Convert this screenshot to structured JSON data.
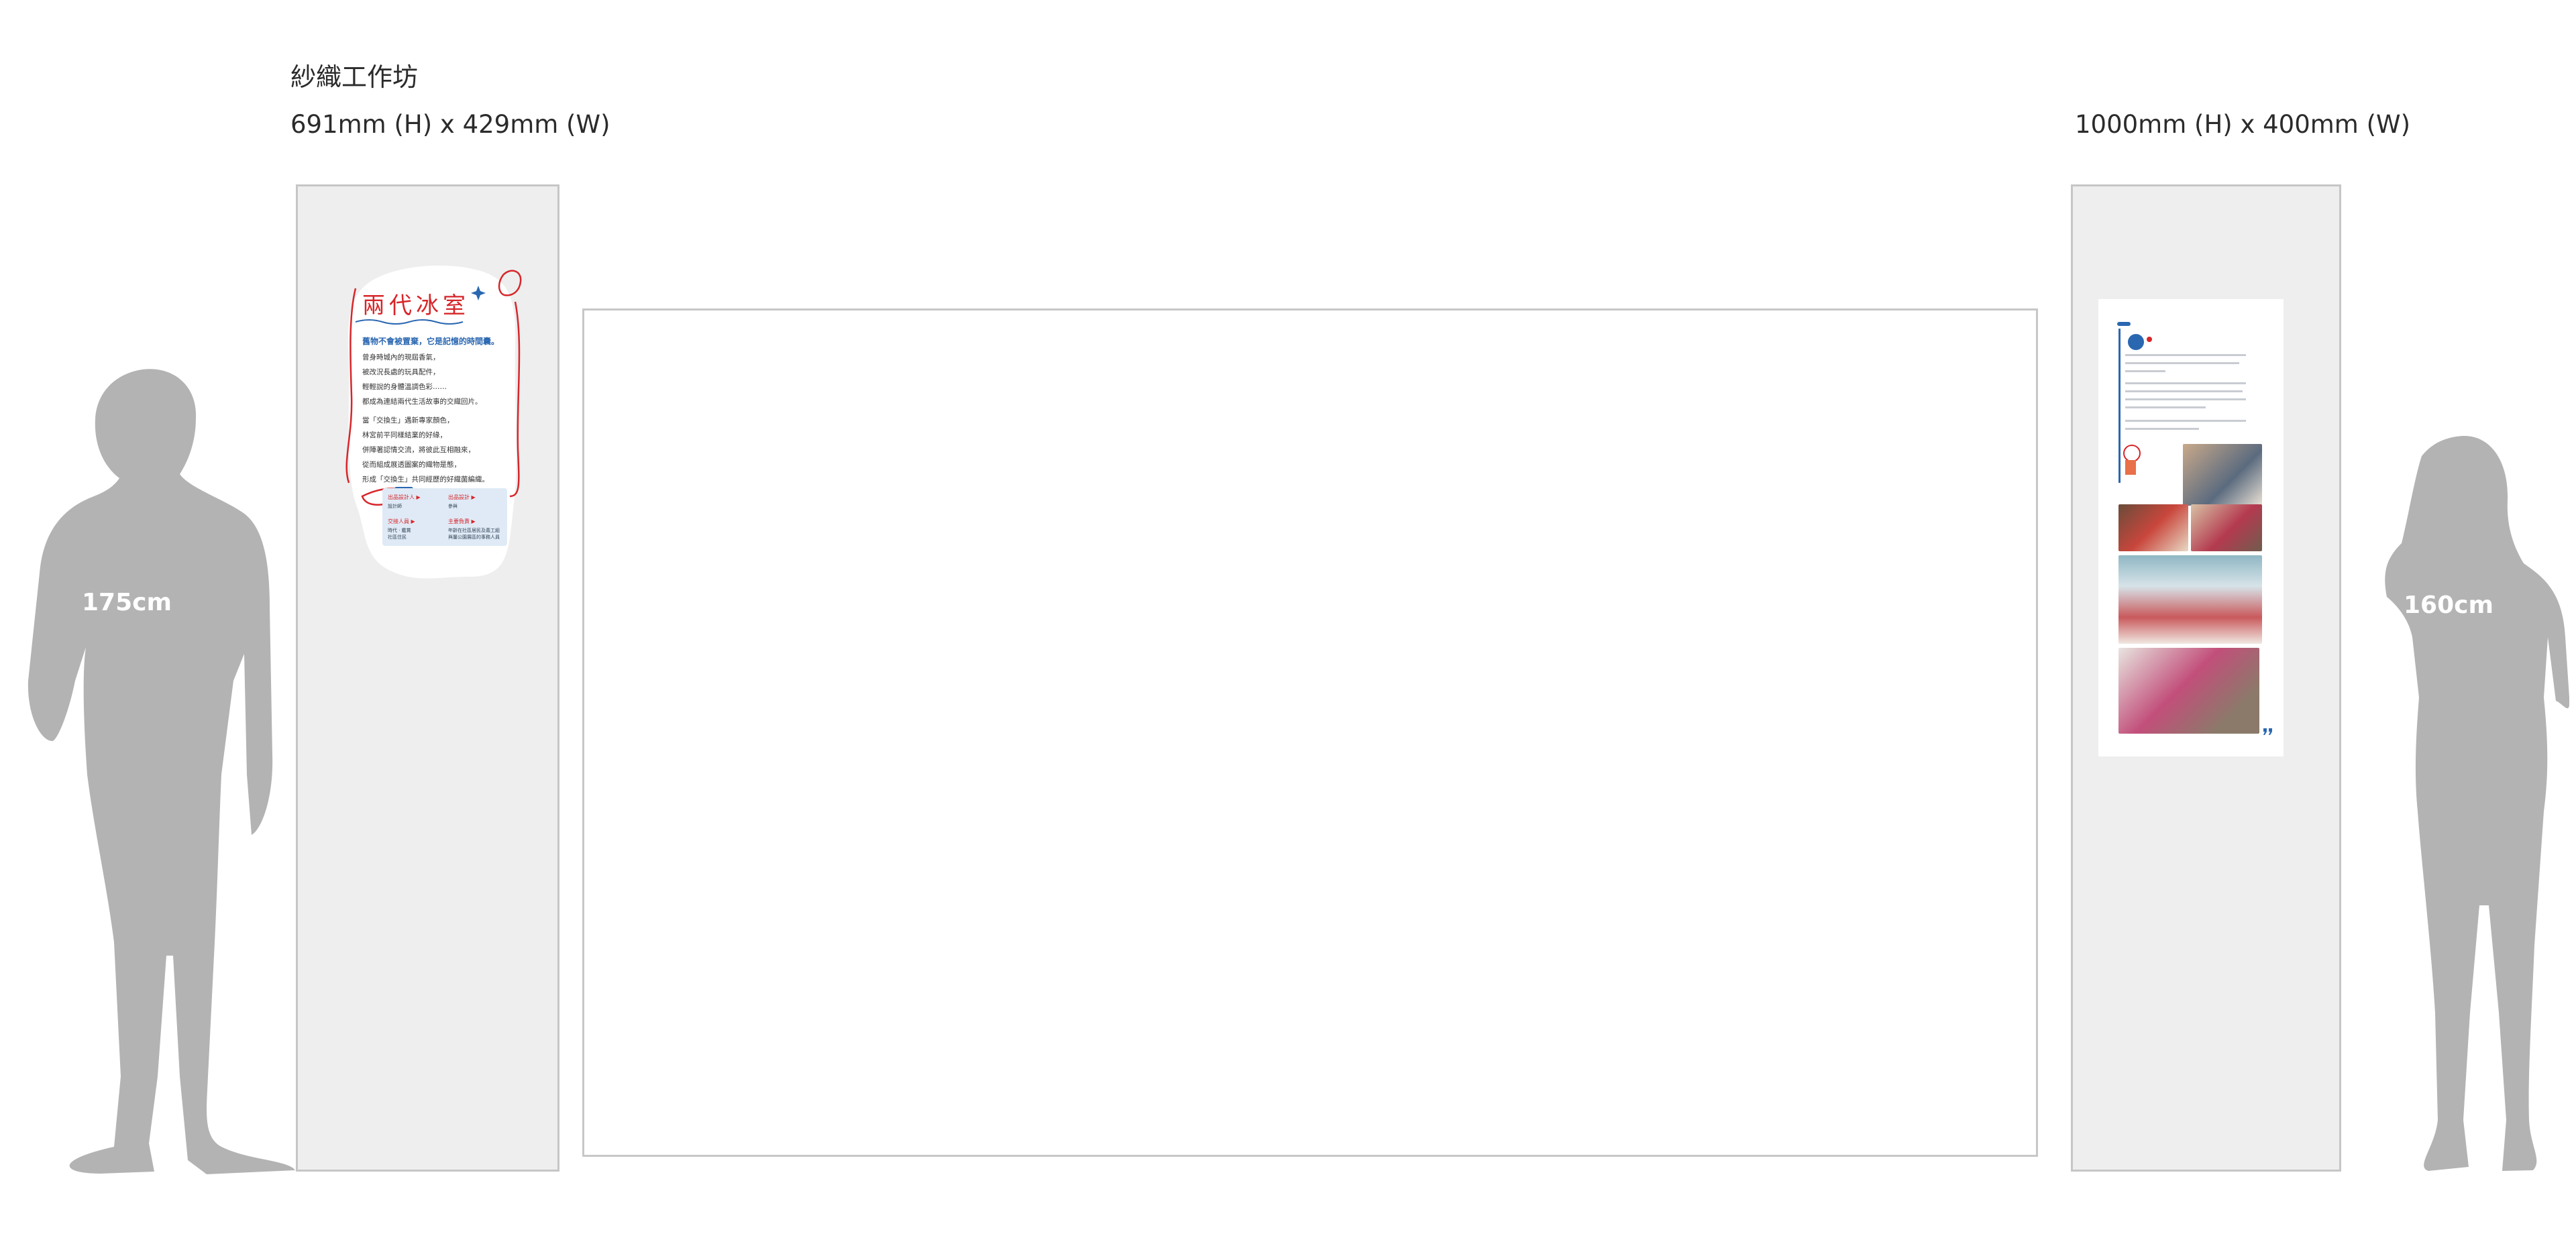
{
  "workshop_title": "紗織工作坊",
  "left_dimension": "691mm (H) x 429mm (W)",
  "right_dimension": "1000mm (H) x 400mm (W)",
  "people": [
    {
      "height_label": "175cm"
    },
    {
      "height_label": "160cm"
    }
  ],
  "left_poster": {
    "title": "兩代冰室",
    "subtitle": "舊物不會被置棄，它是記憶的時間囊。",
    "paragraph1": [
      "曾身時城內的現屆香氣，",
      "被改況長處的玩具配件，",
      "輕輕說的身體溫調色彩……",
      "都成為連結兩代生活故事的交織回片。"
    ],
    "paragraph2": [
      "當「交換生」遇新專家顏色，",
      "林宮前平同樣結業的好緣，",
      "併陣著認情交流，將彼此互相融來，",
      "從而組成展透圖案的織物是態，",
      "形成「交換生」共同經歷的好織菌編織。"
    ],
    "box": {
      "a_title": "出品設計人 ▶",
      "a_sub": "設計師",
      "b_title": "出品設計 ▶",
      "b_sub": "參與",
      "c_title": "交接人員 ▶",
      "c_sub": "時代 · 鑑賞\n社區住民",
      "d_title": "主要負責 ▶",
      "d_sub": "年齡在社區居民及義工組\n與屬公園展區的事務人員"
    }
  },
  "colors": {
    "panel_bg": "#eeeeee",
    "panel_border": "#c6c6c6",
    "silhouette": "#b3b3b3",
    "accent_red": "#d7262a",
    "accent_blue": "#2a67b1"
  }
}
